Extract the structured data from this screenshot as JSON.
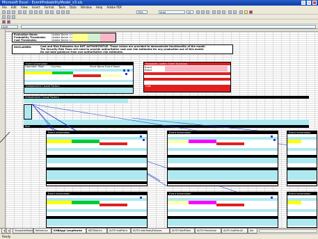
{
  "window": {
    "title": "Microsoft Excel - EventProbabilityModel_v3.xls"
  },
  "menu": [
    "File",
    "Edit",
    "View",
    "Insert",
    "Format",
    "Tools",
    "Data",
    "Window",
    "Help",
    "Adobe PDF"
  ],
  "toolbar": {
    "zoom": "75%",
    "font": "Arial",
    "font_size": "10"
  },
  "name_box": "A26",
  "header_block": {
    "rows": [
      {
        "label": "Evaluation Name:",
        "value": "Update Name >>"
      },
      {
        "label": "Probability Thresholds:",
        "value": "Update Name >>"
      },
      {
        "label": "Cost Thresholds:",
        "value": "Update Name >>"
      }
    ]
  },
  "disclaimer": {
    "label": "DISCLAIMER:",
    "lines": [
      "Cost and Risk Estimates Are NOT AUTHORITATIVE. These values are provided to demonstrate functionality of the model.",
      "The Security Risk Team will need to provide authoritative cost and risk estimates for any production use of this model.",
      "Do not take guidance from non-authoritative risk estimates."
    ]
  },
  "top_event": {
    "title": "Event Information",
    "col_ops": "Operation",
    "col_rate": "Rate",
    "col_csv": "Csv/ress",
    "col_short": "Short Name",
    "col_event": "Event Name"
  },
  "probability_box": {
    "title": "Probability (within Event Duration)",
    "rows": [
      "Event",
      "Event",
      "Cost"
    ]
  },
  "independent": {
    "title": "Independent Causal Factors",
    "sub": "Notes",
    "end": "End"
  },
  "event_blocks": [
    {
      "title": "Event Information"
    },
    {
      "title": "Event Information"
    },
    {
      "title": "Event Information"
    },
    {
      "title": "Event Information"
    },
    {
      "title": "Event Information"
    },
    {
      "title": "Event Information"
    },
    {
      "title": "Event Information"
    },
    {
      "title": "Event Information"
    }
  ],
  "tabs": [
    "TemplateModel",
    "Reference",
    "KHBAggl Lengthwise",
    "KBT/Rollctn",
    "AUTH IndiPoint",
    "AUTH Indirfixes/Failures",
    "AUTH StaffTrain",
    "AUTH Predictive",
    "AUTH IndiPoint2",
    "Att"
  ],
  "active_tab": 2,
  "status": {
    "left": "Ready"
  },
  "colors": {
    "title_bar": "#0a3aa8",
    "event_header": "#000000",
    "accent_cyan": "#aee9f0",
    "accent_red": "#e02020",
    "accent_yellow": "#ffff00",
    "accent_green": "#00cc33",
    "link_lines": "#1d3fcf"
  }
}
